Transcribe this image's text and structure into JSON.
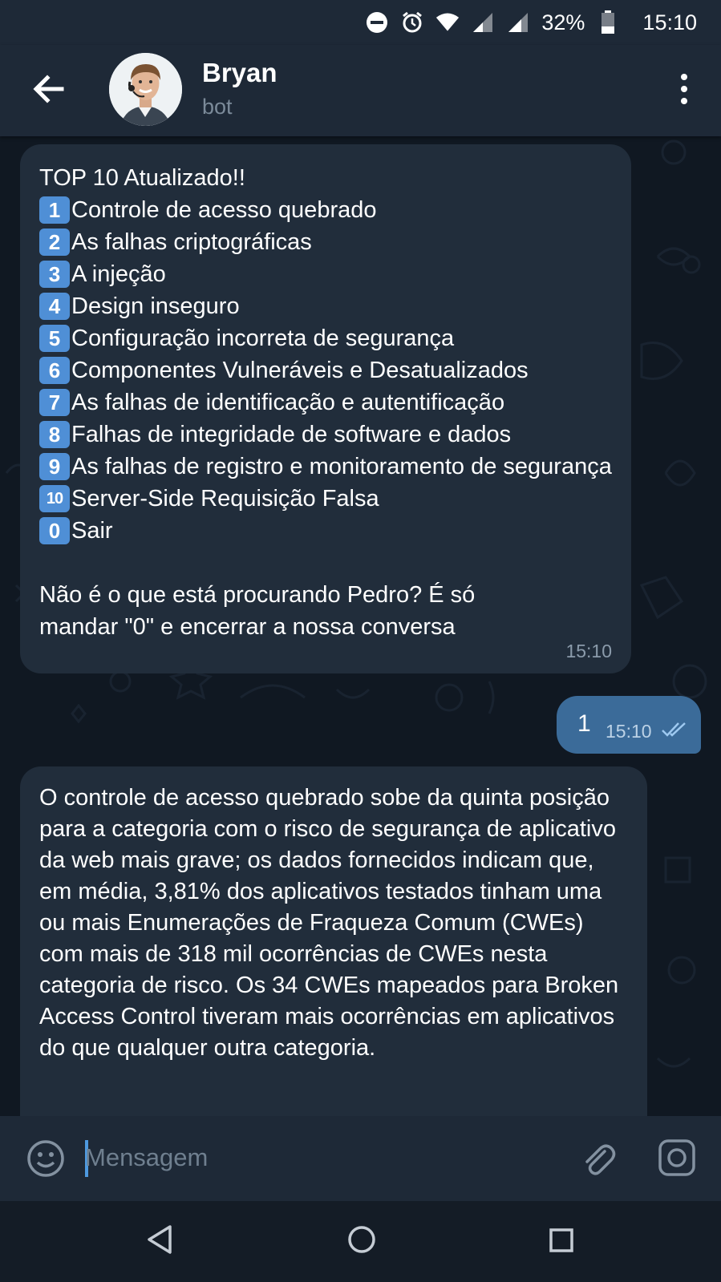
{
  "status_bar": {
    "battery": "32%",
    "time": "15:10",
    "icons": [
      "do-not-disturb-icon",
      "alarm-icon",
      "wifi-icon",
      "signal-icon",
      "signal-icon",
      "battery-icon"
    ]
  },
  "header": {
    "title": "Bryan",
    "subtitle": "bot"
  },
  "messages": {
    "m1": {
      "lines": [
        "TOP 10 Atualizado!!",
        "Controle de acesso quebrado",
        "As falhas criptográficas",
        "A injeção",
        "Design inseguro",
        "Configuração incorreta de segurança",
        "Componentes Vulneráveis e Desatualizados",
        "As falhas de identificação e autentificação",
        "Falhas de integridade de software e dados",
        "As falhas de registro e monitoramento de segurança",
        "Server-Side Requisição Falsa",
        "Sair"
      ],
      "nums": [
        "1",
        "2",
        "3",
        "4",
        "5",
        "6",
        "7",
        "8",
        "9",
        "10",
        "0"
      ],
      "footer": "Não é o que está procurando Pedro? É só mandar \"0\" e encerrar a nossa conversa",
      "time": "15:10"
    },
    "m2": {
      "text": "1",
      "time": "15:10"
    },
    "m3": {
      "text": "O controle de acesso quebrado sobe da quinta posição para a categoria com o risco de segurança de aplicativo da web mais grave; os dados fornecidos indicam que, em média, 3,81% dos aplicativos testados tinham uma ou mais Enumerações de Fraqueza Comum (CWEs) com mais de 318 mil ocorrências de CWEs nesta categoria de risco. Os 34 CWEs mapeados para Broken Access Control tiveram mais ocorrências em aplicativos do que qualquer outra categoria."
    }
  },
  "input": {
    "placeholder": "Mensagem"
  },
  "colors": {
    "header_bg": "#1e2937",
    "incoming_bubble": "#212d3b",
    "outgoing_bubble": "#3b6b99",
    "chat_bg": "#101822",
    "accent": "#4e9ae0"
  }
}
